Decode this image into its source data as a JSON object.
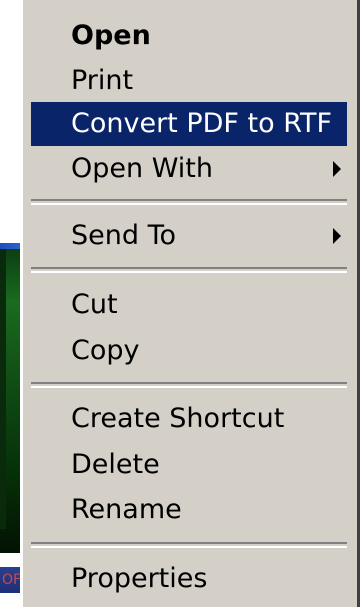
{
  "context_menu": {
    "items": [
      {
        "label": "Open"
      },
      {
        "label": "Print"
      },
      {
        "label": "Convert PDF to RTF"
      },
      {
        "label": "Open With"
      },
      {
        "label": "Send To"
      },
      {
        "label": "Cut"
      },
      {
        "label": "Copy"
      },
      {
        "label": "Create Shortcut"
      },
      {
        "label": "Delete"
      },
      {
        "label": "Rename"
      },
      {
        "label": "Properties"
      }
    ],
    "highlighted_item": "Convert PDF to RTF",
    "default_item": "Open"
  },
  "background": {
    "taskbar_text": "OF"
  },
  "colors": {
    "menu_background": "#d4d0c8",
    "highlight_background": "#0a246a",
    "highlight_text": "#ffffff",
    "text": "#000000"
  },
  "icons": {
    "submenu": "submenu-arrow-icon"
  }
}
